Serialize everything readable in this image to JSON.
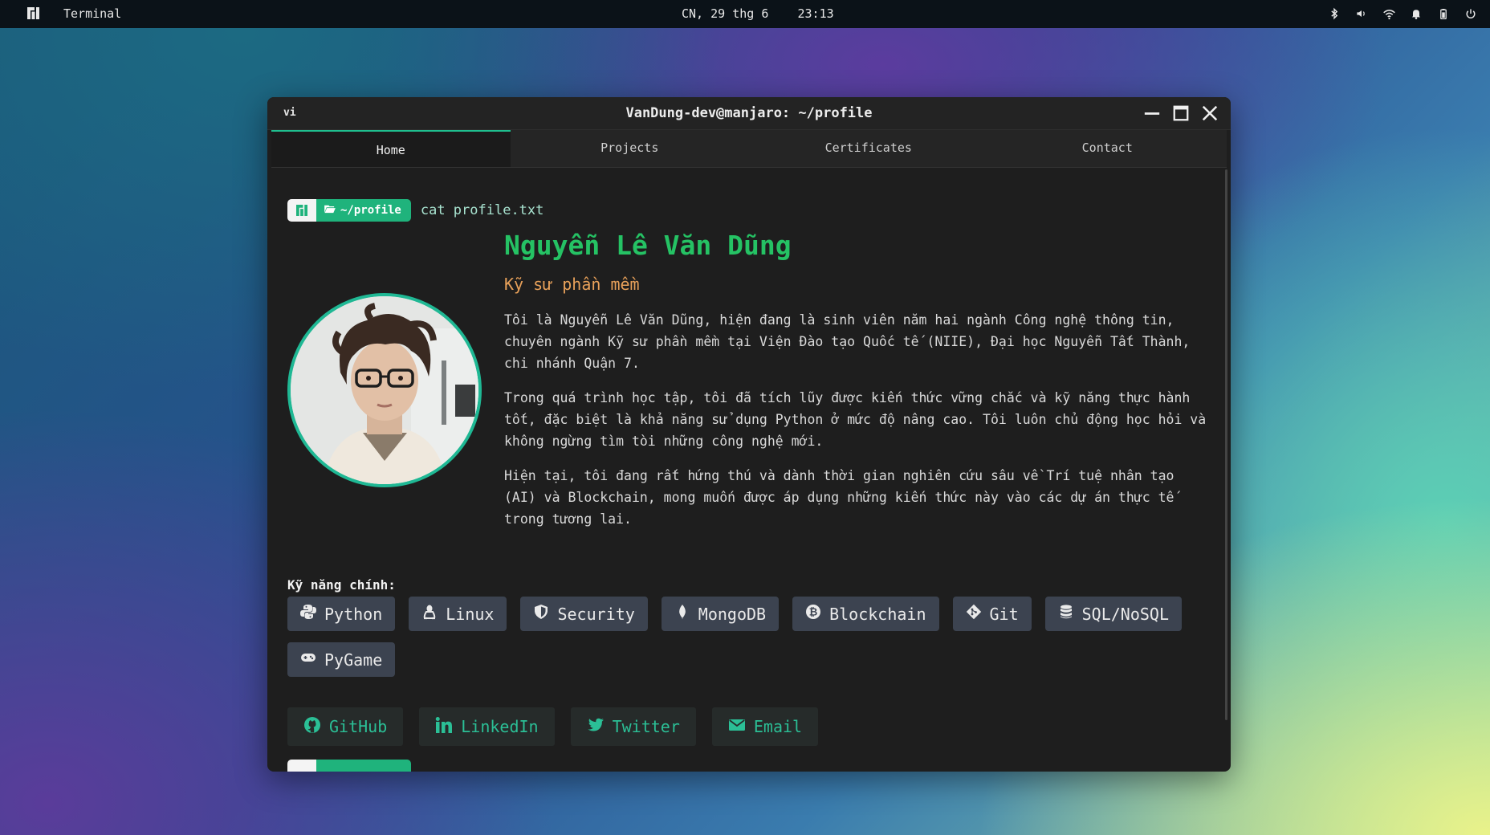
{
  "topbar": {
    "app_name": "Terminal",
    "clock": "CN, 29 thg 6    23:13",
    "tray_icons": [
      "bluetooth-icon",
      "volume-icon",
      "wifi-icon",
      "bell-icon",
      "battery-icon",
      "power-icon"
    ]
  },
  "window": {
    "lang": "vi",
    "title": "VanDung-dev@manjaro: ~/profile",
    "tabs": [
      {
        "label": "Home",
        "active": true
      },
      {
        "label": "Projects",
        "active": false
      },
      {
        "label": "Certificates",
        "active": false
      },
      {
        "label": "Contact",
        "active": false
      }
    ]
  },
  "prompt": {
    "path": "~/profile",
    "command": "cat profile.txt"
  },
  "profile": {
    "name": "Nguyễn Lê Văn Dũng",
    "role": "Kỹ sư phần mềm",
    "bio": [
      "Tôi là Nguyễn Lê Văn Dũng, hiện đang là sinh viên năm hai ngành Công nghệ thông tin, chuyên ngành Kỹ sư phần mềm tại Viện Đào tạo Quốc tế (NIIE), Đại học Nguyễn Tất Thành, chi nhánh Quận 7.",
      "Trong quá trình học tập, tôi đã tích lũy được kiến thức vững chắc và kỹ năng thực hành tốt, đặc biệt là khả năng sử dụng Python ở mức độ nâng cao. Tôi luôn chủ động học hỏi và không ngừng tìm tòi những công nghệ mới.",
      "Hiện tại, tôi đang rất hứng thú và dành thời gian nghiên cứu sâu về Trí tuệ nhân tạo (AI) và Blockchain, mong muốn được áp dụng những kiến thức này vào các dự án thực tế trong tương lai."
    ]
  },
  "skills": {
    "label": "Kỹ năng chính:",
    "items": [
      {
        "label": "Python",
        "icon": "python-icon"
      },
      {
        "label": "Linux",
        "icon": "linux-icon"
      },
      {
        "label": "Security",
        "icon": "shield-icon"
      },
      {
        "label": "MongoDB",
        "icon": "mongodb-icon"
      },
      {
        "label": "Blockchain",
        "icon": "bitcoin-icon"
      },
      {
        "label": "Git",
        "icon": "git-icon"
      },
      {
        "label": "SQL/NoSQL",
        "icon": "database-icon"
      },
      {
        "label": "PyGame",
        "icon": "gamepad-icon"
      }
    ]
  },
  "socials": [
    {
      "label": "GitHub",
      "icon": "github-icon"
    },
    {
      "label": "LinkedIn",
      "icon": "linkedin-icon"
    },
    {
      "label": "Twitter",
      "icon": "twitter-icon"
    },
    {
      "label": "Email",
      "icon": "envelope-icon"
    }
  ],
  "colors": {
    "accent": "#1fb37c",
    "name": "#25c264",
    "role": "#e8a15a",
    "social_text": "#2bbf96"
  }
}
